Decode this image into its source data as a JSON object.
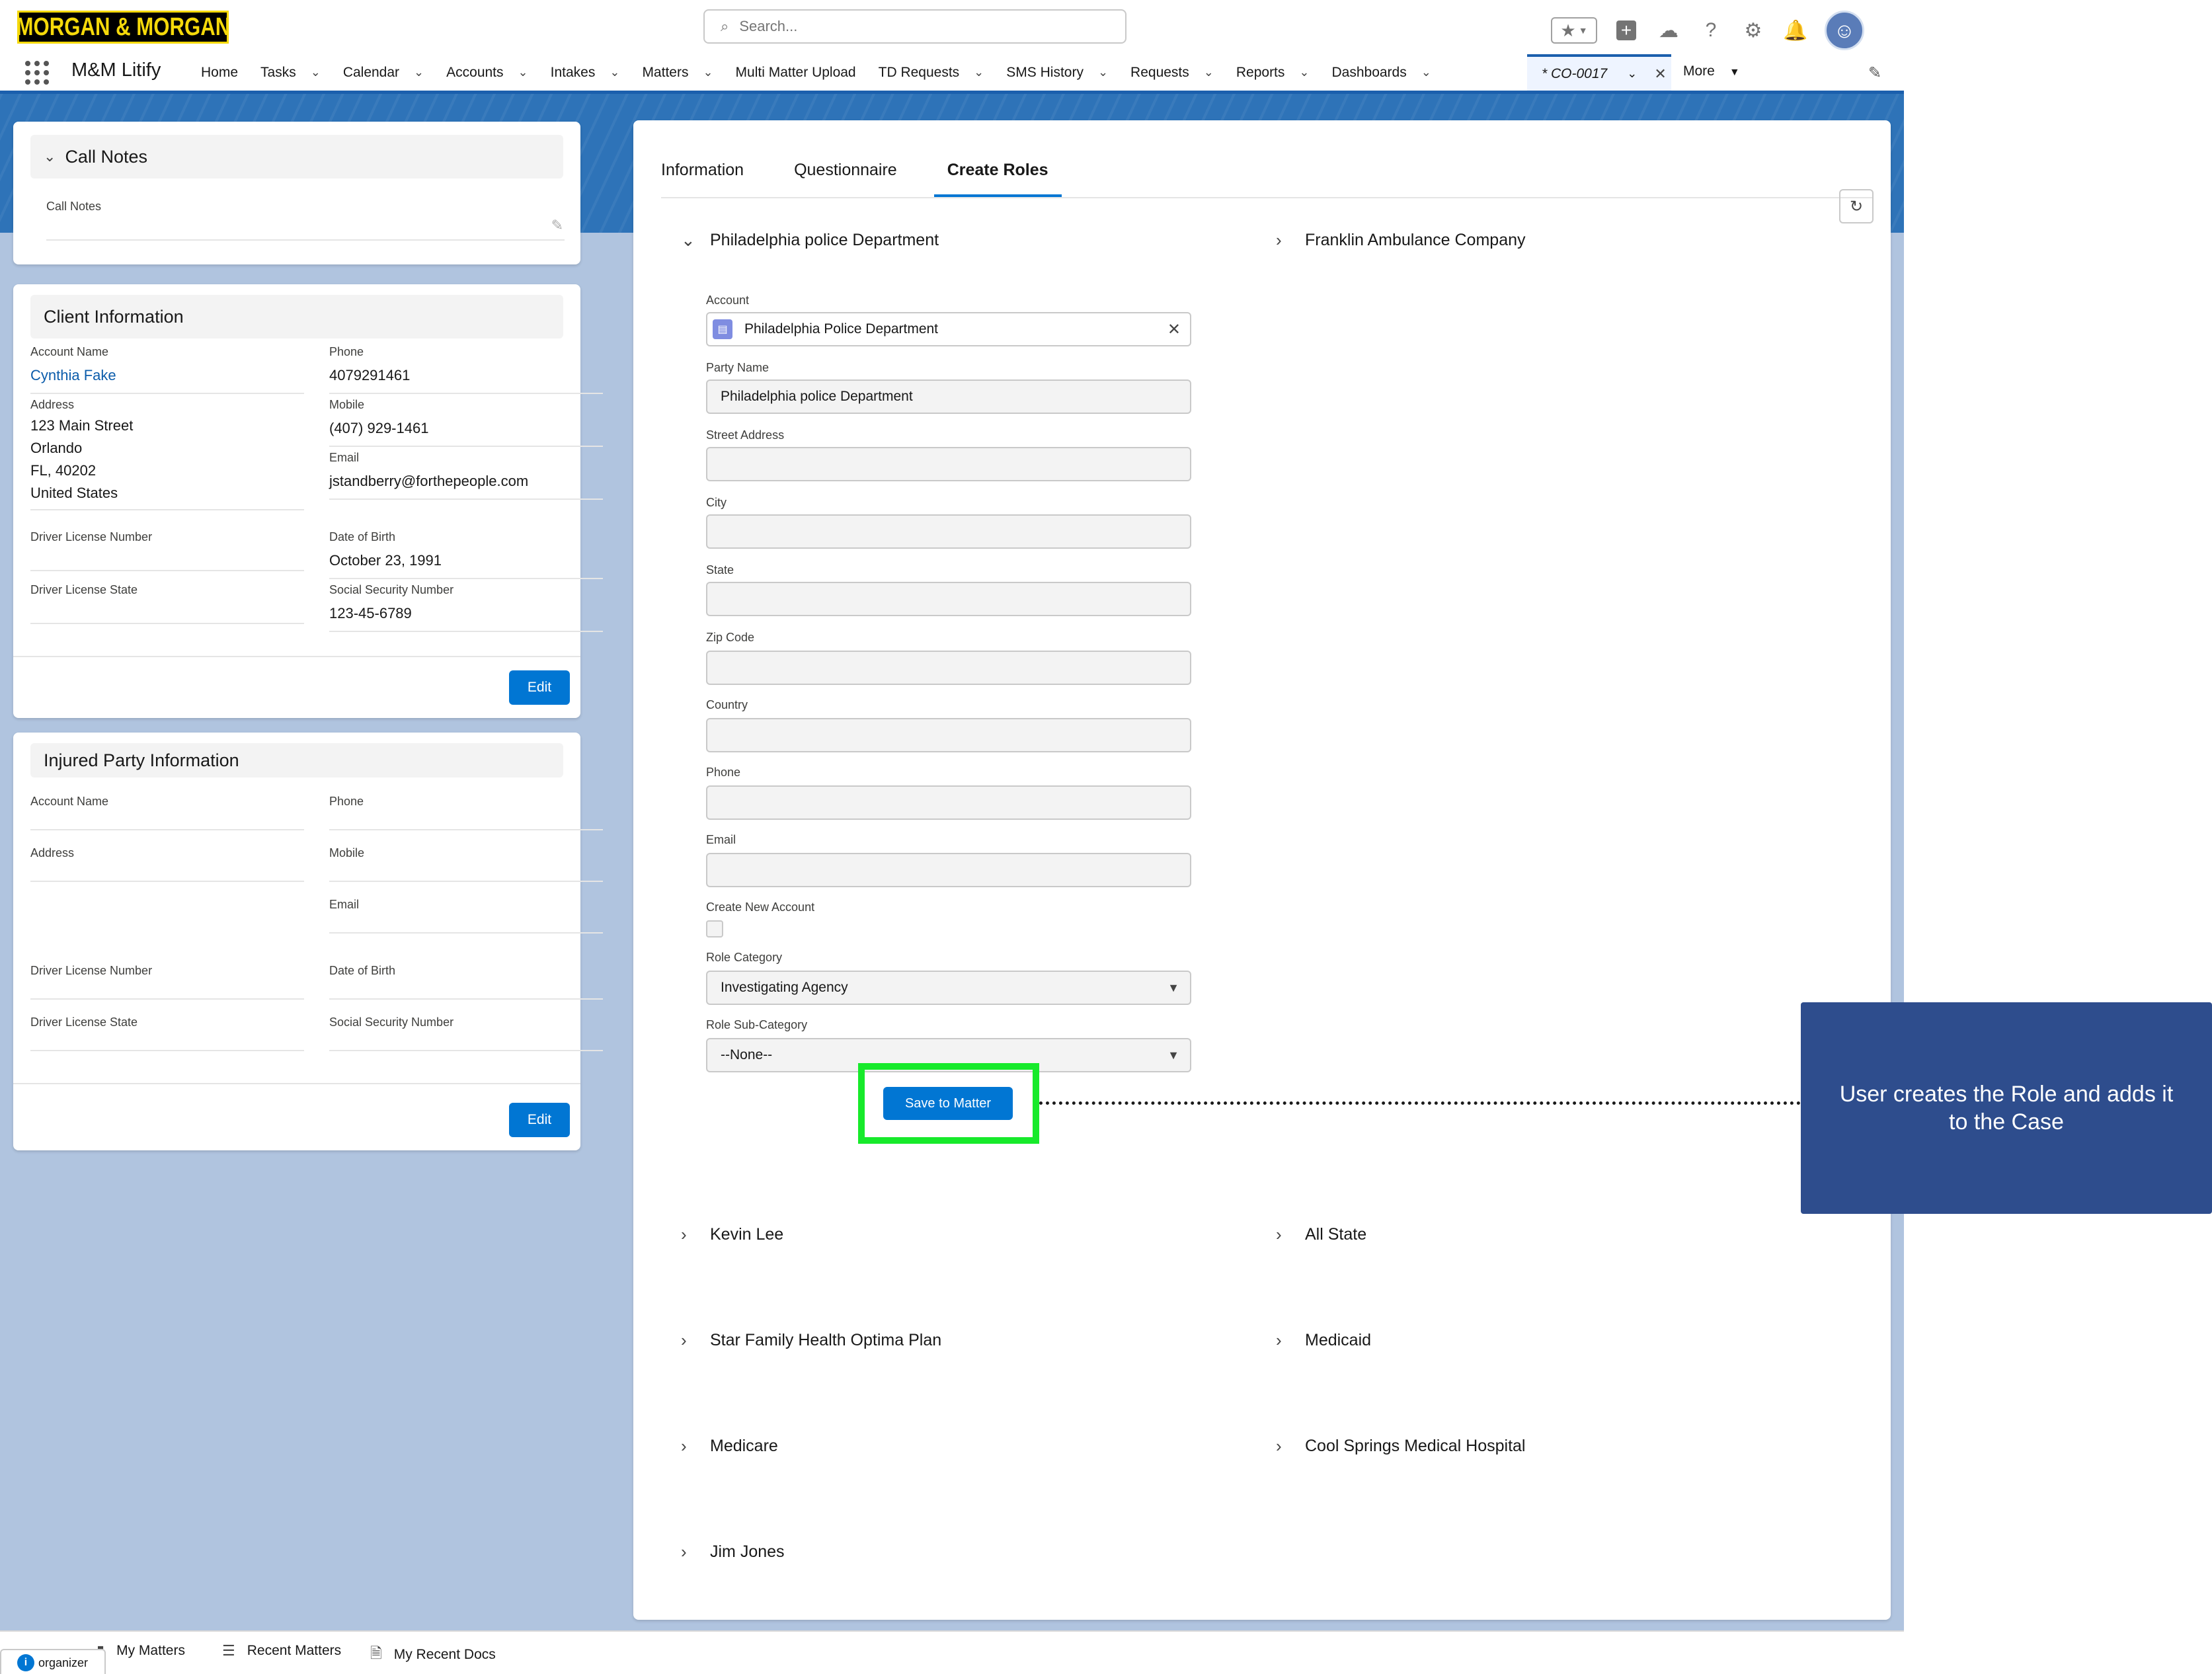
{
  "header": {
    "logo_text": "MORGAN & MORGAN",
    "search_placeholder": "Search...",
    "icons": [
      "favorites-star-icon",
      "add-icon",
      "trailhead-icon",
      "help-icon",
      "gear-icon",
      "bell-icon",
      "avatar-icon"
    ]
  },
  "nav": {
    "app_name": "M&M Litify",
    "items": [
      {
        "label": "Home",
        "dropdown": false
      },
      {
        "label": "Tasks",
        "dropdown": true
      },
      {
        "label": "Calendar",
        "dropdown": true
      },
      {
        "label": "Accounts",
        "dropdown": true
      },
      {
        "label": "Intakes",
        "dropdown": true
      },
      {
        "label": "Matters",
        "dropdown": true
      },
      {
        "label": "Multi Matter Upload",
        "dropdown": false
      },
      {
        "label": "TD Requests",
        "dropdown": true
      },
      {
        "label": "SMS History",
        "dropdown": true
      },
      {
        "label": "Requests",
        "dropdown": true
      },
      {
        "label": "Reports",
        "dropdown": true
      },
      {
        "label": "Dashboards",
        "dropdown": true
      }
    ],
    "active_tab": "* CO-0017",
    "more_label": "More"
  },
  "call_notes": {
    "title": "Call Notes",
    "field_label": "Call Notes"
  },
  "client_info": {
    "title": "Client Information",
    "account_name_label": "Account Name",
    "account_name": "Cynthia Fake",
    "phone_label": "Phone",
    "phone": "4079291461",
    "address_label": "Address",
    "address_lines": [
      "123 Main Street",
      "Orlando",
      "FL, 40202",
      "United States"
    ],
    "mobile_label": "Mobile",
    "mobile": "(407) 929-1461",
    "email_label": "Email",
    "email": "jstandberry@forthepeople.com",
    "dl_number_label": "Driver License Number",
    "dob_label": "Date of Birth",
    "dob": "October 23, 1991",
    "dl_state_label": "Driver License State",
    "ssn_label": "Social Security Number",
    "ssn": "123-45-6789",
    "edit_label": "Edit"
  },
  "injured_party": {
    "title": "Injured Party Information",
    "account_name_label": "Account Name",
    "phone_label": "Phone",
    "address_label": "Address",
    "mobile_label": "Mobile",
    "email_label": "Email",
    "dl_number_label": "Driver License Number",
    "dob_label": "Date of Birth",
    "dl_state_label": "Driver License State",
    "ssn_label": "Social Security Number",
    "edit_label": "Edit"
  },
  "main": {
    "tabs": [
      "Information",
      "Questionnaire",
      "Create Roles"
    ],
    "active_tab": "Create Roles",
    "expanded_section": "Philadelphia police Department",
    "form": {
      "account_label": "Account",
      "account_value": "Philadelphia Police Department",
      "party_name_label": "Party Name",
      "party_name_value": "Philadelphia police Department",
      "street_label": "Street Address",
      "city_label": "City",
      "state_label": "State",
      "zip_label": "Zip Code",
      "country_label": "Country",
      "phone_label": "Phone",
      "email_label": "Email",
      "create_account_label": "Create New Account",
      "create_account_checked": false,
      "role_category_label": "Role Category",
      "role_category_value": "Investigating Agency",
      "role_subcategory_label": "Role Sub-Category",
      "role_subcategory_value": "--None--",
      "save_label": "Save to Matter"
    },
    "sections_right_top": "Franklin Ambulance Company",
    "sections_left": [
      "Kevin Lee",
      "Star Family Health Optima Plan",
      "Medicare",
      "Jim Jones"
    ],
    "sections_right": [
      "All State",
      "Medicaid",
      "Cool Springs Medical Hospital"
    ]
  },
  "callout": {
    "text": "User creates the Role and adds it to the Case"
  },
  "utility_bar": {
    "organizer_label": "organizer",
    "items": [
      "My Matters",
      "Recent Matters",
      "My Recent Docs"
    ]
  },
  "colors": {
    "brand_blue": "#0176d3",
    "highlight_green": "#17ea2b",
    "callout_bg": "#2e4d8d"
  }
}
